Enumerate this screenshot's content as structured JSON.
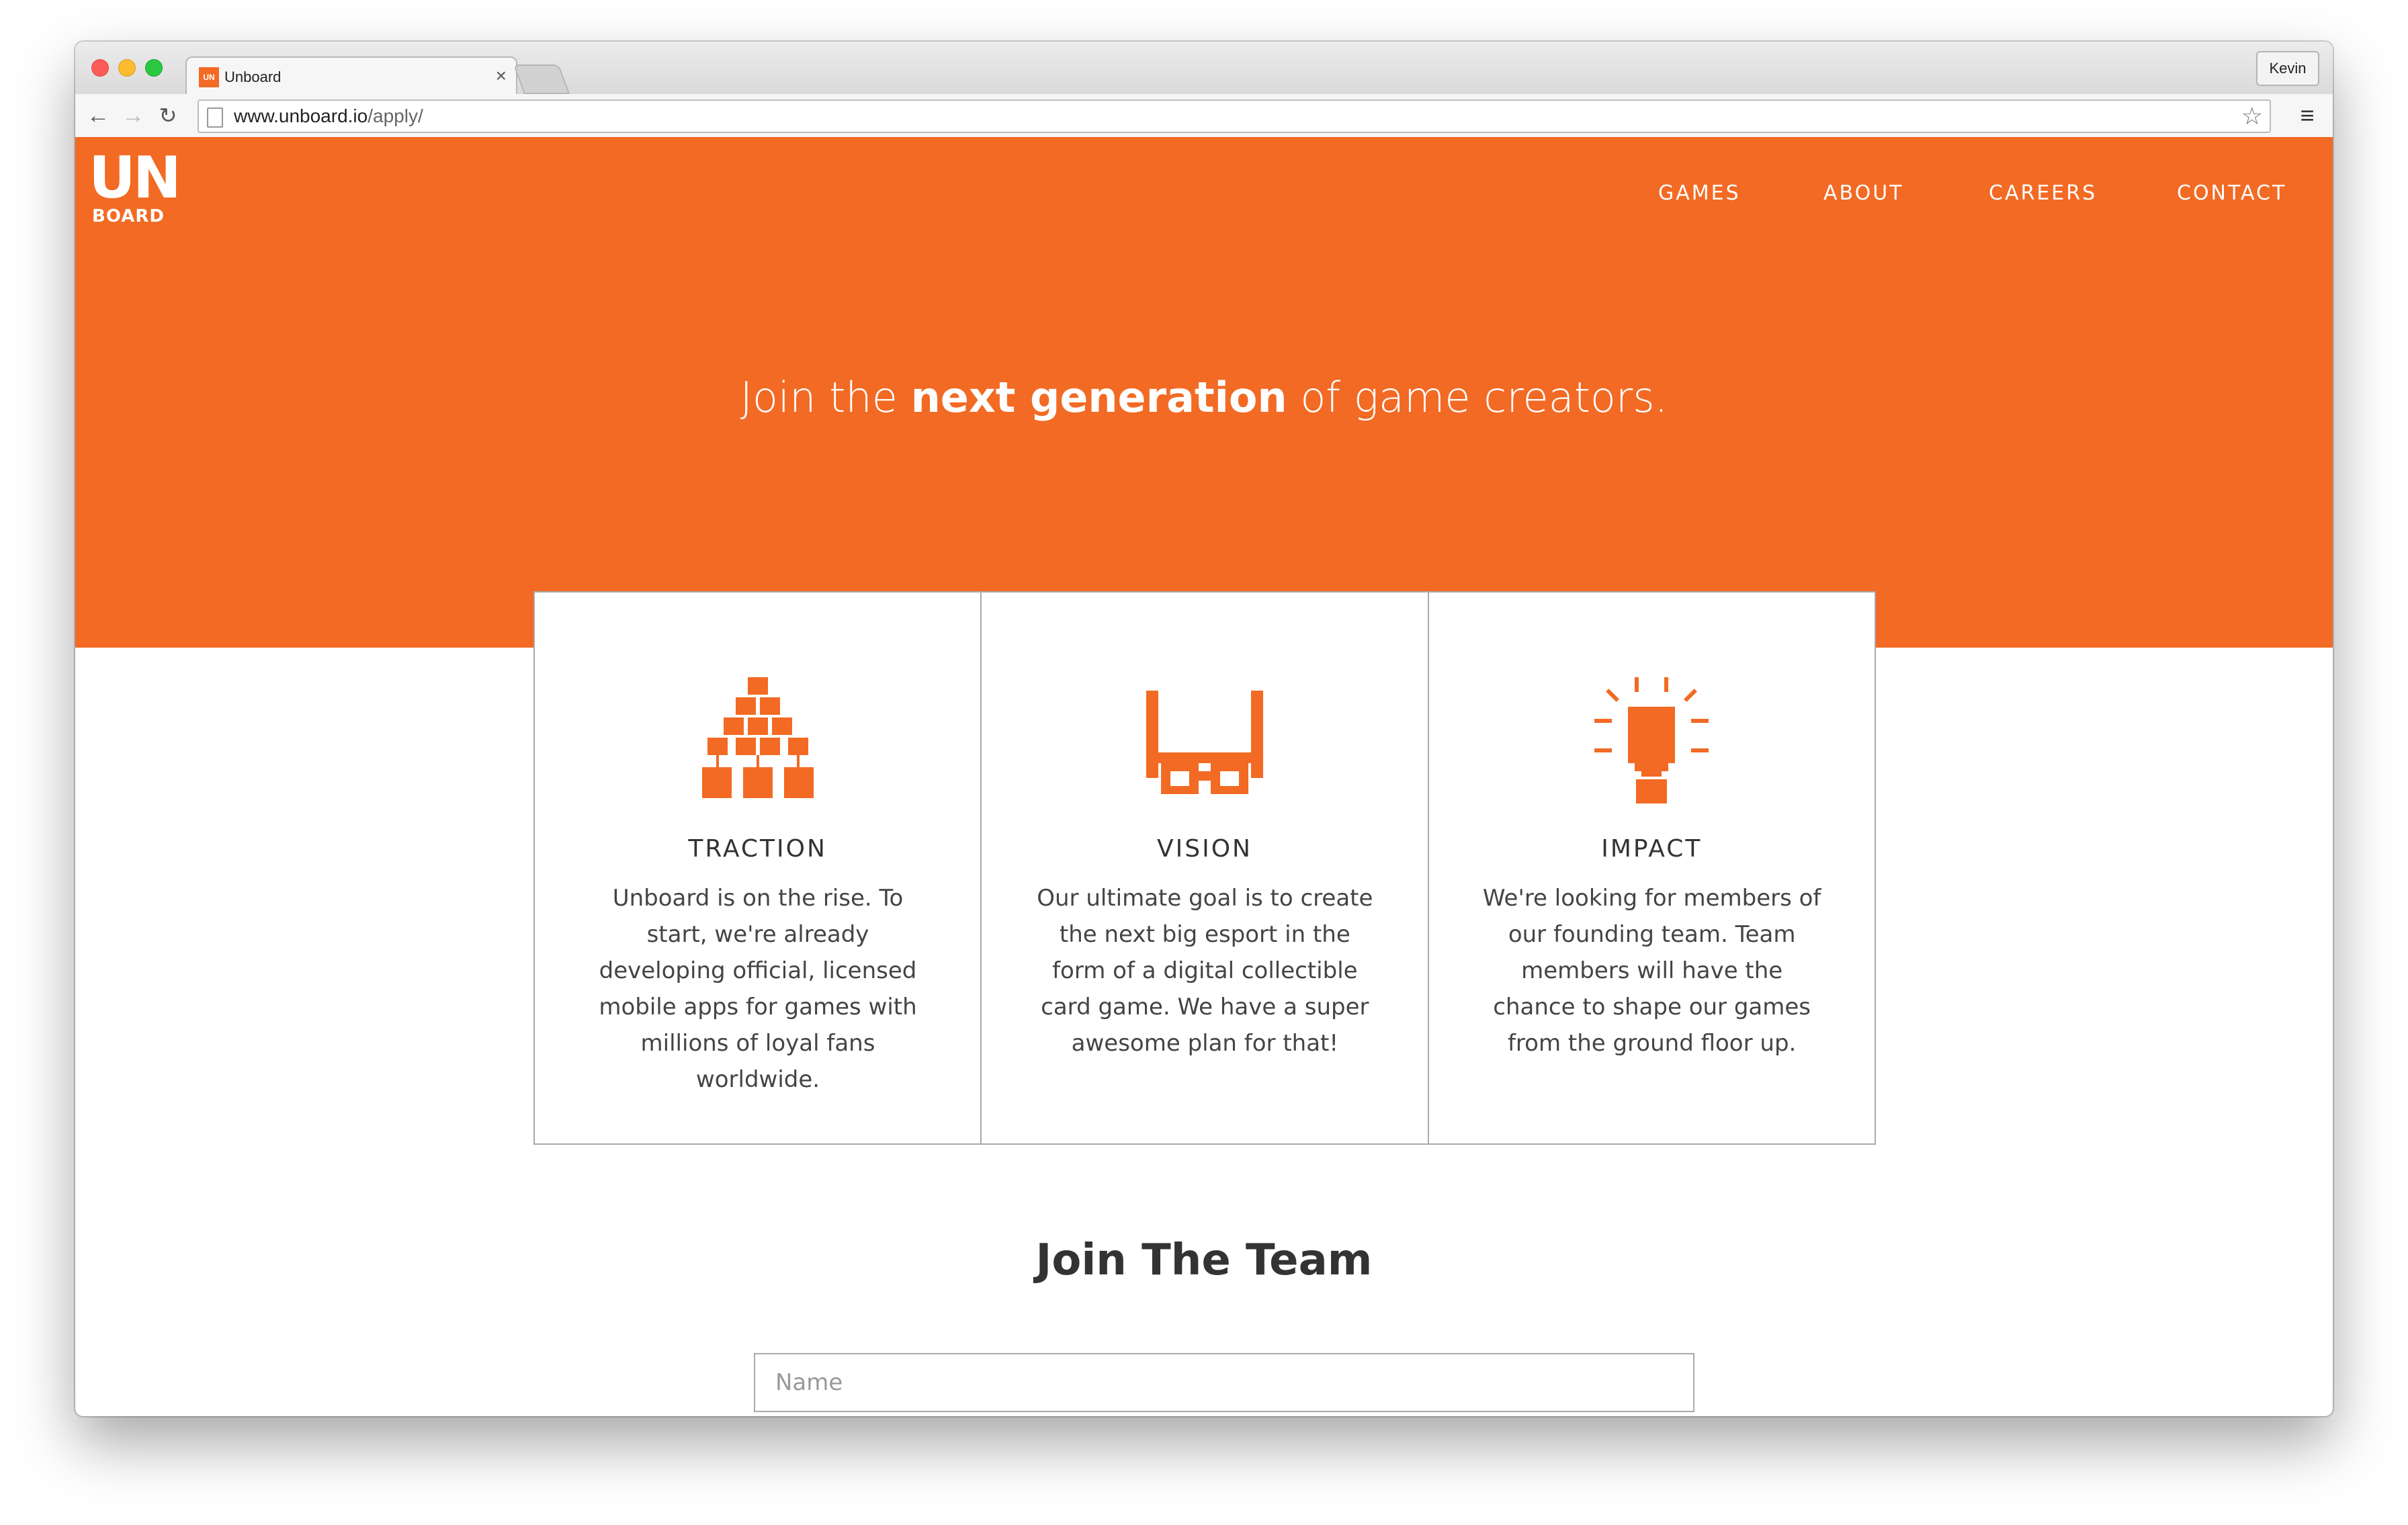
{
  "browser": {
    "tab_title": "Unboard",
    "tab_close": "×",
    "tab_favicon": "UN",
    "profile_name": "Kevin",
    "url_host": "www.unboard.io",
    "url_path": "/apply/",
    "icons": {
      "back": "arrow-left-icon",
      "forward": "arrow-right-icon",
      "reload": "reload-icon",
      "star": "star-icon",
      "menu": "hamburger-menu-icon",
      "page": "page-icon"
    }
  },
  "brand": {
    "logo_top": "UN",
    "logo_bottom": "BOARD",
    "accent_color": "#f26a24"
  },
  "nav": {
    "items": [
      "GAMES",
      "ABOUT",
      "CAREERS",
      "CONTACT"
    ]
  },
  "hero": {
    "headline_pre": "Join the ",
    "headline_bold": "next generation",
    "headline_post": " of game creators."
  },
  "cards": [
    {
      "icon": "stacked-blocks-icon",
      "title": "TRACTION",
      "text": "Unboard is on the rise. To start, we're already developing official, licensed mobile apps for games with millions of loyal fans worldwide."
    },
    {
      "icon": "pixel-glasses-icon",
      "title": "VISION",
      "text": "Our ultimate goal is to create the next big esport in the form of a digital collectible card game. We have a super awesome plan for that!"
    },
    {
      "icon": "lightbulb-icon",
      "title": "IMPACT",
      "text": "We're looking for members of our founding team. Team members will have the chance to shape our games from the ground floor up."
    }
  ],
  "join": {
    "title": "Join The Team",
    "name_placeholder": "Name"
  }
}
